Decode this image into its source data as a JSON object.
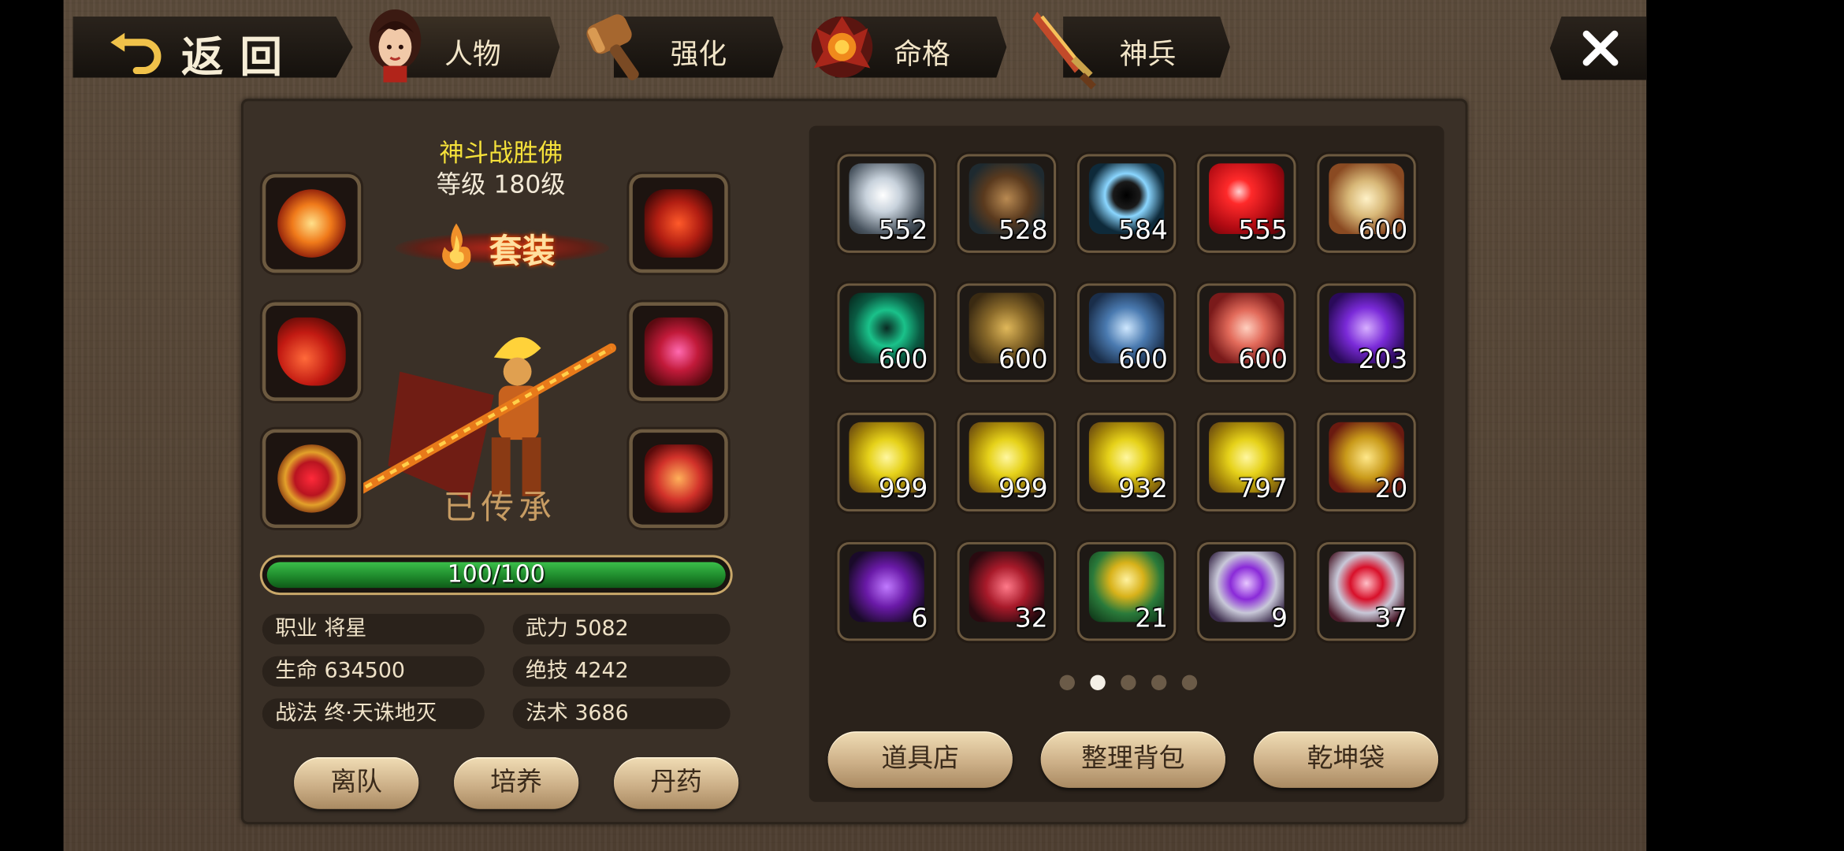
{
  "tabs": {
    "back": "返回",
    "character": "人物",
    "enhance": "强化",
    "fate": "命格",
    "weapon": "神兵"
  },
  "hero": {
    "name": "神斗战胜佛",
    "level": "等级 180级",
    "set_label": "套装",
    "inherited": "已传承",
    "hp_bar_text": "100/100",
    "hp_fraction": 1.0
  },
  "stats": {
    "job": "职业 将星",
    "life": "生命 634500",
    "tactic": "战法 终·天诛地灭",
    "power": "武力 5082",
    "skill": "绝技 4242",
    "magic": "法术 3686"
  },
  "char_buttons": {
    "leave": "离队",
    "train": "培养",
    "pill": "丹药"
  },
  "inventory": {
    "items": [
      {
        "icon": "silver-ore-icon",
        "count": "552"
      },
      {
        "icon": "branch-icon",
        "count": "528"
      },
      {
        "icon": "dark-orb-icon",
        "count": "584"
      },
      {
        "icon": "ruby-icon",
        "count": "555"
      },
      {
        "icon": "dragon-skull-icon",
        "count": "600"
      },
      {
        "icon": "jade-stone-icon",
        "count": "600"
      },
      {
        "icon": "armor-icon",
        "count": "600"
      },
      {
        "icon": "blue-book-icon",
        "count": "600"
      },
      {
        "icon": "red-statue-icon",
        "count": "600"
      },
      {
        "icon": "purple-token-icon",
        "count": "203"
      },
      {
        "icon": "gold-tablet-icon",
        "count": "999"
      },
      {
        "icon": "gold-tablet-icon",
        "count": "999"
      },
      {
        "icon": "gold-tablet-icon",
        "count": "932"
      },
      {
        "icon": "gold-tablet-icon",
        "count": "797"
      },
      {
        "icon": "gold-ornate-tablet-icon",
        "count": "20"
      },
      {
        "icon": "purple-fruit-bowl-icon",
        "count": "6"
      },
      {
        "icon": "red-fruit-bowl-icon",
        "count": "32"
      },
      {
        "icon": "green-chest-icon",
        "count": "21"
      },
      {
        "icon": "purple-orb-icon",
        "count": "9"
      },
      {
        "icon": "red-orb-icon",
        "count": "37"
      }
    ],
    "page": 2,
    "page_count": 5
  },
  "bag_buttons": {
    "shop": "道具店",
    "sort": "整理背包",
    "bag": "乾坤袋"
  },
  "colors": {
    "title_yellow": "#f5e13a",
    "hp_green": "#1f8a2c",
    "frame_gold": "#6d5a40"
  }
}
